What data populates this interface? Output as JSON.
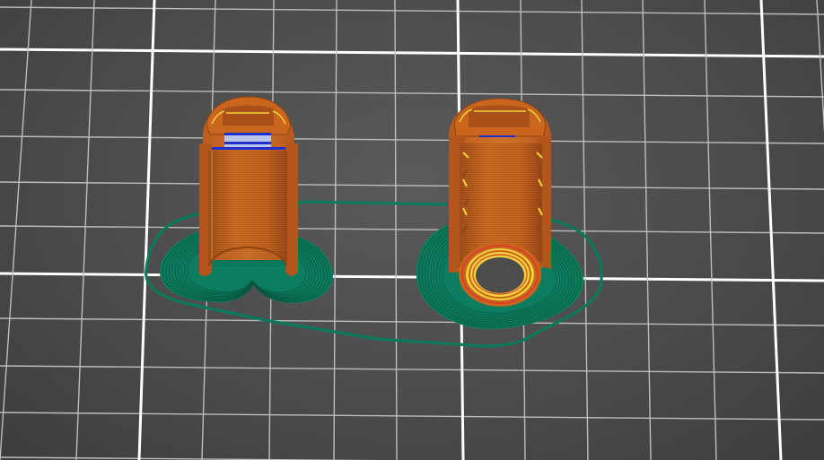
{
  "scene": {
    "type": "slicer-gcode-preview",
    "colors": {
      "background": "#4a4a4a",
      "grid_major": "#ffffff",
      "grid_minor": "#bdbdbd",
      "outer_wall": "#c9651c",
      "outer_wall_shade": "#a9501a",
      "inner_wall": "#f0d33c",
      "overhang": "#d8422a",
      "bridge": "#1e2fd0",
      "infill_highlight": "#b9c6e8",
      "skirt_brim": "#0b7a5c",
      "brim_line": "#08553f"
    },
    "icons": [
      "skirt-outline",
      "brim",
      "part-left",
      "part-right"
    ]
  }
}
